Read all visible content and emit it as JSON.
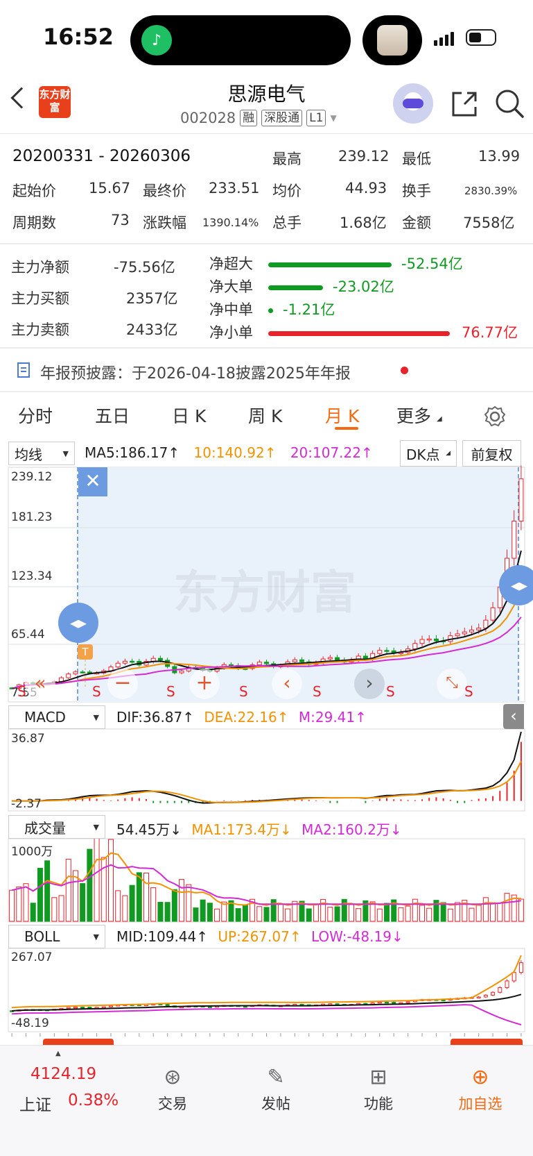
{
  "status": {
    "time": "16:52"
  },
  "header": {
    "logo_text": "东方财富",
    "title": "思源电气",
    "code": "002028",
    "tags": [
      "融",
      "深股通",
      "L1"
    ]
  },
  "range": {
    "period": "20200331 - 20260306",
    "high_label": "最高",
    "high": "239.12",
    "low_label": "最低",
    "low": "13.99",
    "open_label": "起始价",
    "open": "15.67",
    "close_label": "最终价",
    "close": "233.51",
    "avg_label": "均价",
    "avg": "44.93",
    "turnover_label": "换手",
    "turnover": "2830.39%",
    "periods_label": "周期数",
    "periods": "73",
    "change_label": "涨跌幅",
    "change": "1390.14%",
    "volume_label": "总手",
    "volume": "1.68亿",
    "amount_label": "金额",
    "amount": "7558亿"
  },
  "flow": {
    "net_label": "主力净额",
    "net": "-75.56亿",
    "buy_label": "主力买额",
    "buy": "2357亿",
    "sell_label": "主力卖额",
    "sell": "2433亿",
    "items": [
      {
        "label": "净超大",
        "value": "-52.54亿",
        "ratio": 0.68,
        "color": "#119a22"
      },
      {
        "label": "净大单",
        "value": "-23.02亿",
        "ratio": 0.3,
        "color": "#119a22"
      },
      {
        "label": "净中单",
        "value": "-1.21亿",
        "ratio": 0.02,
        "color": "#119a22"
      },
      {
        "label": "净小单",
        "value": "76.77亿",
        "ratio": 1.0,
        "color": "#e8232b"
      }
    ]
  },
  "notice": {
    "text": "年报预披露：于2026-04-18披露2025年年报"
  },
  "tabs": [
    "分时",
    "五日",
    "日 K",
    "周 K",
    "月 K",
    "更多"
  ],
  "kline": {
    "select": "均线",
    "ma5": "MA5:186.17",
    "ma10": "10:140.92",
    "ma20": "20:107.22",
    "dk_button": "DK点",
    "fq_button": "前复权",
    "y_labels": [
      "239.12",
      "181.23",
      "123.34",
      "65.44",
      "7.55"
    ],
    "watermark": "东方财富",
    "signal_letter": "S"
  },
  "macd": {
    "select": "MACD",
    "dif": "DIF:36.87",
    "dea": "DEA:22.16",
    "m": "M:29.41",
    "y_top": "36.87",
    "y_bottom": "-2.37"
  },
  "vol": {
    "select": "成交量",
    "v": "54.45万",
    "ma1": "MA1:173.4万",
    "ma2": "MA2:160.2万",
    "y_top": "1000万"
  },
  "boll": {
    "select": "BOLL",
    "mid": "MID:109.44",
    "up": "UP:267.07",
    "low": "LOW:-48.19",
    "y_top": "267.07",
    "y_bottom": "-48.19"
  },
  "bottom": {
    "index_value": "4124.19",
    "index_name": "上证",
    "index_change": "0.38%",
    "nav": [
      {
        "label": "交易",
        "icon": "yen-icon"
      },
      {
        "label": "发帖",
        "icon": "edit-icon"
      },
      {
        "label": "功能",
        "icon": "grid-icon"
      },
      {
        "label": "加自选",
        "icon": "plus-circle-icon"
      }
    ]
  },
  "colors": {
    "up": "#e8232b",
    "down": "#119a22",
    "accent": "#f36a12"
  }
}
